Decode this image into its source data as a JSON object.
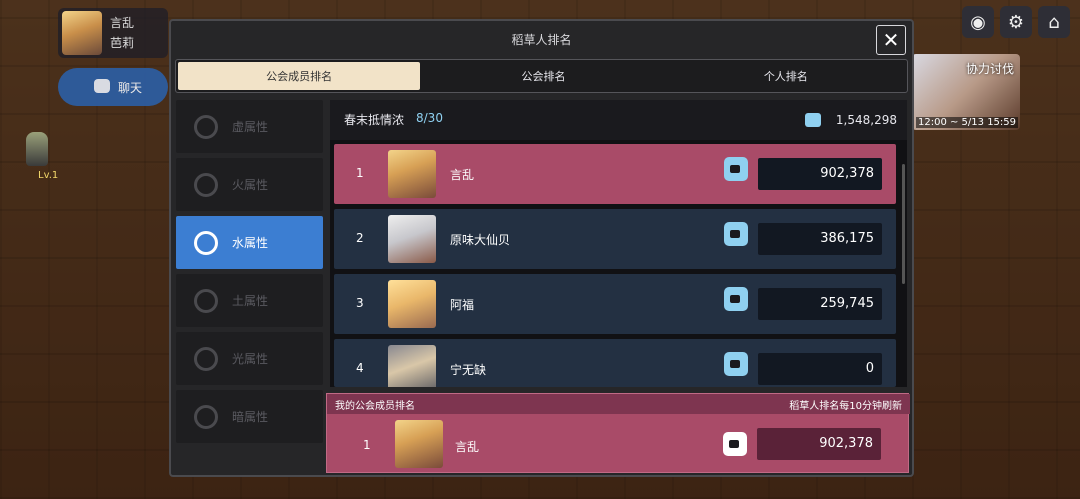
{
  "player": {
    "name": "言乱",
    "title": "芭莉",
    "level": "Lv.1"
  },
  "chat": {
    "label": "聊天"
  },
  "event": {
    "title": "协力讨伐",
    "date": "12:00 ~ 5/13 15:59"
  },
  "top_icons": [
    "map-icon",
    "gear-icon",
    "home-icon"
  ],
  "panel": {
    "title": "稻草人排名",
    "close": "✕",
    "tabs": [
      {
        "label": "公会成员排名",
        "active": true
      },
      {
        "label": "公会排名",
        "active": false
      },
      {
        "label": "个人排名",
        "active": false
      }
    ],
    "elements": [
      {
        "label": "虚属性",
        "active": false
      },
      {
        "label": "火属性",
        "active": false
      },
      {
        "label": "水属性",
        "active": true
      },
      {
        "label": "土属性",
        "active": false
      },
      {
        "label": "光属性",
        "active": false
      },
      {
        "label": "暗属性",
        "active": false
      }
    ],
    "guild": {
      "name": "春末抵情浓",
      "count": "8/30",
      "total": "1,548,298"
    },
    "rows": [
      {
        "rank": "1",
        "name": "言乱",
        "value": "902,378"
      },
      {
        "rank": "2",
        "name": "原味大仙贝",
        "value": "386,175"
      },
      {
        "rank": "3",
        "name": "阿福",
        "value": "259,745"
      },
      {
        "rank": "4",
        "name": "宁无缺",
        "value": "0"
      }
    ],
    "mine": {
      "header": "我的公会成员排名",
      "note": "稻草人排名每10分钟刷新",
      "rank": "1",
      "name": "言乱",
      "value": "902,378"
    }
  }
}
